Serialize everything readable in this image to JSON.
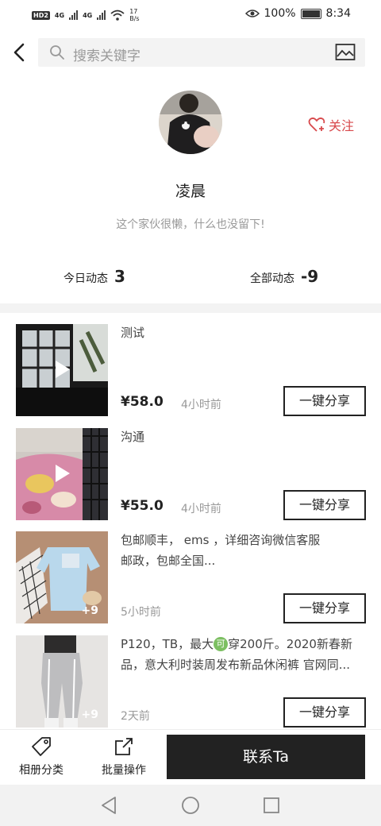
{
  "status_bar": {
    "hd": "HD",
    "hd_sub": "2",
    "net1": "4G",
    "net2": "4G",
    "speed_value": "17",
    "speed_unit": "B/s",
    "battery": "100%",
    "time": "8:34"
  },
  "header": {
    "search_placeholder": "搜索关键字"
  },
  "profile": {
    "name": "凌晨",
    "bio": "这个家伙很懒，什么也没留下!",
    "follow_label": "关注",
    "today_label": "今日动态",
    "today_count": "3",
    "all_label": "全部动态",
    "all_count": "-9"
  },
  "items": [
    {
      "desc": "测试",
      "price": "¥58.0",
      "time": "4小时前",
      "share": "一键分享"
    },
    {
      "desc": "沟通",
      "price": "¥55.0",
      "time": "4小时前",
      "share": "一键分享"
    },
    {
      "desc_line1": "包邮顺丰， ems ，详细咨询微信客服",
      "desc_line2": "邮政，包邮全国...",
      "time": "5小时前",
      "share": "一键分享",
      "more": "+9"
    },
    {
      "desc_line1a": "P120，TB，最大",
      "desc_line1b": "穿200斤。2020新春新",
      "desc_line2": "品，意大利时装周发布新品休闲裤 官网同...",
      "emoji": "可",
      "time": "2天前",
      "share": "一键分享",
      "more": "+9"
    }
  ],
  "toolbar": {
    "album_label": "相册分类",
    "batch_label": "批量操作",
    "contact_label": "联系Ta"
  }
}
